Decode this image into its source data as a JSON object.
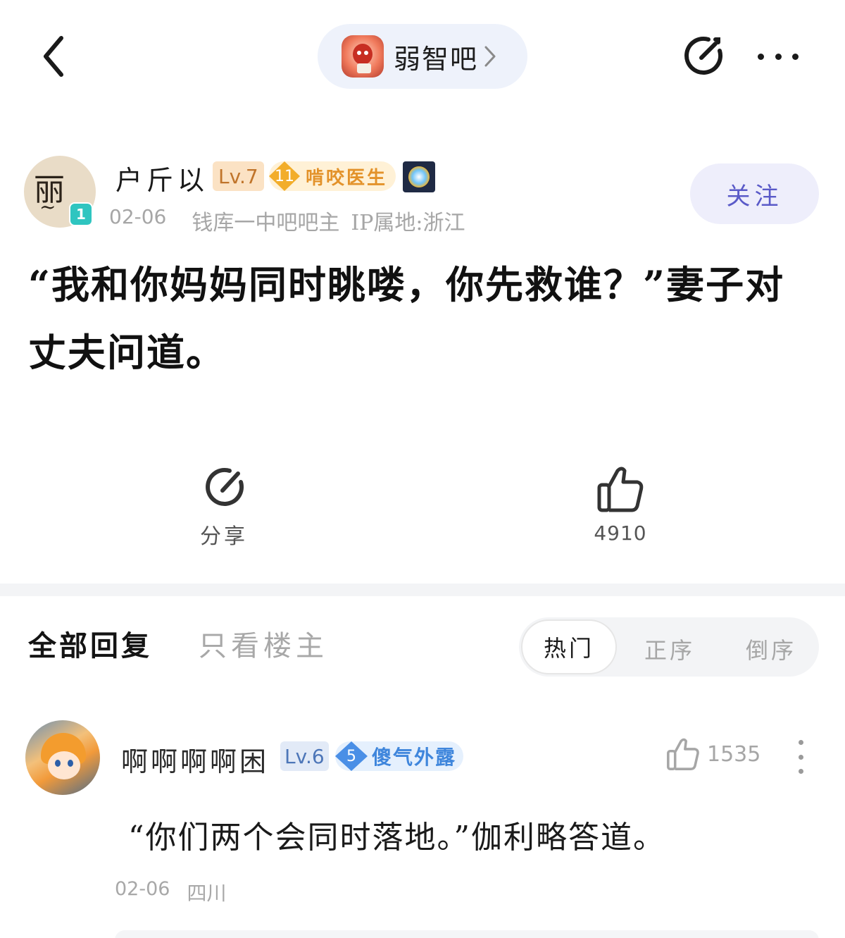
{
  "header": {
    "forum_name": "弱智吧"
  },
  "author": {
    "name": "户斤以",
    "avatar_text": "丽",
    "avatar_badge": "1",
    "level": "Lv.7",
    "title_badge_num": "11",
    "title_badge_text": "啃咬医生",
    "date": "02-06",
    "role": "钱库一中吧吧主",
    "ip": "IP属地:浙江",
    "follow_label": "关注"
  },
  "post": {
    "text": "“我和你妈妈同时眺喽，你先救谁？”妻子对丈夫问道。"
  },
  "actions": {
    "share_label": "分享",
    "like_count": "4910"
  },
  "tabs": {
    "all_replies": "全部回复",
    "owner_only": "只看楼主",
    "sort_hot": "热门",
    "sort_asc": "正序",
    "sort_desc": "倒序"
  },
  "reply": {
    "name": "啊啊啊啊困",
    "level": "Lv.6",
    "title_badge_num": "5",
    "title_badge_text": "傻气外露",
    "like_count": "1535",
    "text": "“你们两个会同时落地。”伽利略答道。",
    "date": "02-06",
    "location": "四川"
  },
  "colors": {
    "follow_bg": "#eeeefb",
    "follow_text": "#5a5ac8",
    "pill_bg": "#eef2fb",
    "level_orange": "#c0742a",
    "level_blue": "#4d76b8"
  }
}
